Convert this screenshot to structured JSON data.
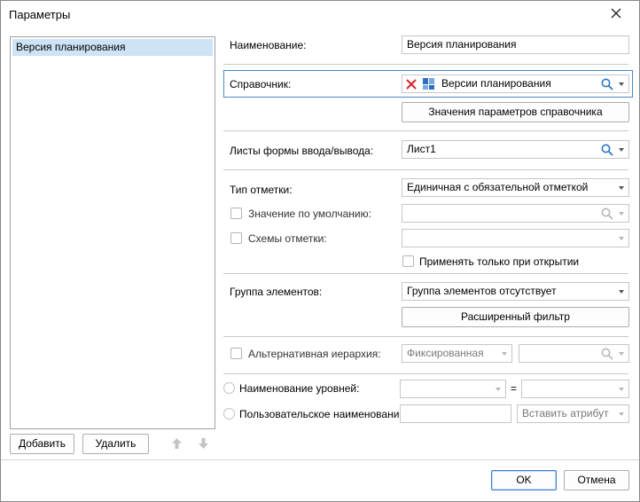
{
  "window": {
    "title": "Параметры"
  },
  "left": {
    "items": [
      "Версия планирования"
    ],
    "add_label": "Добавить",
    "delete_label": "Удалить"
  },
  "form": {
    "name_label": "Наименование:",
    "name_value": "Версия планирования",
    "dict_label": "Справочник:",
    "dict_value": "Версии планирования",
    "dict_params_button": "Значения параметров справочника",
    "sheets_label": "Листы формы ввода/вывода:",
    "sheets_value": "Лист1",
    "mark_type_label": "Тип отметки:",
    "mark_type_value": "Единичная с обязательной отметкой",
    "default_value_label": "Значение по умолчанию:",
    "mark_schemes_label": "Схемы отметки:",
    "apply_on_open_label": "Применять только при открытии",
    "group_label": "Группа элементов:",
    "group_value": "Группа элементов отсутствует",
    "ext_filter_button": "Расширенный фильтр",
    "alt_hierarchy_label": "Альтернативная иерархия:",
    "alt_hierarchy_value": "Фиксированная",
    "level_names_label": "Наименование уровней:",
    "equals_sign": "=",
    "custom_name_label": "Пользовательское наименование:",
    "insert_attr_label": "Вставить атрибут"
  },
  "footer": {
    "ok_label": "OK",
    "cancel_label": "Отмена"
  },
  "colors": {
    "accent": "#4a87c8",
    "selection": "#cde3f6",
    "clear_red": "#d9262c",
    "search_blue": "#2a77c9"
  }
}
